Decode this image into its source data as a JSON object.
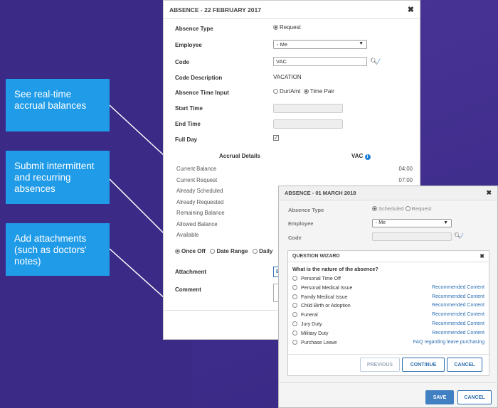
{
  "callouts": [
    "See real-time accrual  balances",
    "Submit intermittent and recurring absences",
    "Add attachments (such as doctors' notes)"
  ],
  "dialog1": {
    "title": "ABSENCE - 22 FEBRUARY 2017",
    "close": "✖",
    "absence_type_label": "Absence Type",
    "absence_type_value": "Request",
    "employee_label": "Employee",
    "employee_value": "- Me",
    "code_label": "Code",
    "code_value": "VAC",
    "code_desc_label": "Code Description",
    "code_desc_value": "VACATION",
    "time_input_label": "Absence Time Input",
    "time_input_opt1": "Dur/Amt",
    "time_input_opt2": "Time Pair",
    "start_label": "Start Time",
    "end_label": "End Time",
    "full_day_label": "Full Day",
    "accrual_header": "Accrual Details",
    "accrual_code": "VAC",
    "accrual_rows": [
      {
        "label": "Current Balance",
        "value": "04:00"
      },
      {
        "label": "Current Request",
        "value": "07:00"
      },
      {
        "label": "Already Scheduled",
        "value": ""
      },
      {
        "label": "Already Requested",
        "value": ""
      },
      {
        "label": "Remaining Balance",
        "value": ""
      },
      {
        "label": "Allowed Balance",
        "value": ""
      },
      {
        "label": "Available",
        "value": ""
      }
    ],
    "occurrence_opts": [
      "Once Off",
      "Date Range",
      "Daily"
    ],
    "attachment_label": "Attachment",
    "attachment_btn": "B",
    "comment_label": "Comment"
  },
  "dialog2": {
    "title": "ABSENCE - 01 MARCH 2018",
    "close": "✖",
    "absence_type_label": "Absence Type",
    "type_opt1": "Scheduled",
    "type_opt2": "Request",
    "employee_label": "Employee",
    "employee_value": "- Me",
    "code_label": "Code",
    "save": "SAVE",
    "cancel": "CANCEL"
  },
  "wizard": {
    "title": "QUESTION WIZARD",
    "question": "What is the nature of the absence?",
    "options": [
      {
        "label": "Personal Time Off",
        "link": ""
      },
      {
        "label": "Personal Medical Issue",
        "link": "Recommended Content"
      },
      {
        "label": "Family Medical Issue",
        "link": "Recommended Content"
      },
      {
        "label": "Child Birth or Adoption",
        "link": "Recommended Content"
      },
      {
        "label": "Funeral",
        "link": "Recommended Content"
      },
      {
        "label": "Jury Duty",
        "link": "Recommended Content"
      },
      {
        "label": "Military Duty",
        "link": "Recommended Content"
      },
      {
        "label": "Purchase Leave",
        "link": "FAQ regarding leave purchasing"
      }
    ],
    "previous": "PREVIOUS",
    "continue": "CONTINUE",
    "cancel": "CANCEL"
  }
}
